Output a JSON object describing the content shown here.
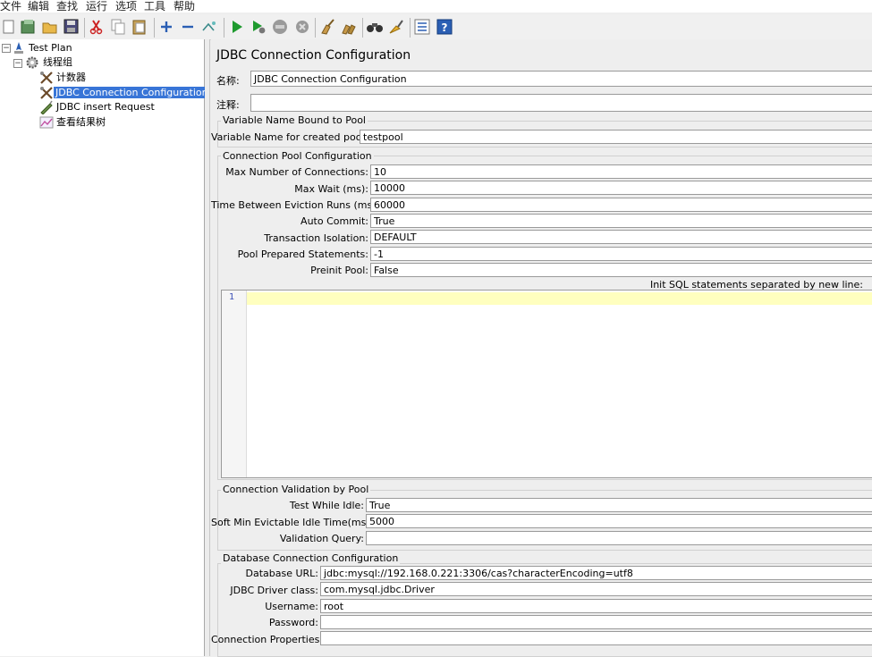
{
  "menu": [
    "文件",
    "编辑",
    "查找",
    "运行",
    "选项",
    "工具",
    "帮助"
  ],
  "toolbar_icons": [
    "new-icon",
    "templates-icon",
    "open-icon",
    "save-icon",
    "cut-icon",
    "copy-icon",
    "paste-icon",
    "expand-icon",
    "collapse-icon",
    "toggle-icon",
    "start-icon",
    "start-no-pause-icon",
    "stop-icon",
    "shutdown-icon",
    "clear-icon",
    "clear-all-icon",
    "search-icon",
    "reset-search-icon",
    "function-helper-icon",
    "help-icon"
  ],
  "tree": {
    "test_plan": "Test Plan",
    "thread_group": "线程组",
    "counter": "计数器",
    "jdbc_config": "JDBC Connection Configuration",
    "jdbc_request": "JDBC insert Request",
    "results_tree": "查看结果树"
  },
  "panel": {
    "title": "JDBC Connection Configuration",
    "name_label": "名称:",
    "name_value": "JDBC Connection Configuration",
    "comment_label": "注释:",
    "comment_value": "",
    "variable_group": {
      "title": "Variable Name Bound to Pool",
      "label": "Variable Name for created pool:",
      "value": "testpool"
    },
    "pool_group": {
      "title": "Connection Pool Configuration",
      "max_conn_label": "Max Number of Connections:",
      "max_conn_value": "10",
      "max_wait_label": "Max Wait (ms):",
      "max_wait_value": "10000",
      "eviction_label": "Time Between Eviction Runs (ms):",
      "eviction_value": "60000",
      "autocommit_label": "Auto Commit:",
      "autocommit_value": "True",
      "isolation_label": "Transaction Isolation:",
      "isolation_value": "DEFAULT",
      "prepared_label": "Pool Prepared Statements:",
      "prepared_value": "-1",
      "preinit_label": "Preinit Pool:",
      "preinit_value": "False",
      "init_sql_label": "Init SQL statements separated by new line:",
      "init_sql_line": "1"
    },
    "validation_group": {
      "title": "Connection Validation by Pool",
      "idle_label": "Test While Idle:",
      "idle_value": "True",
      "evictable_label": "Soft Min Evictable Idle Time(ms):",
      "evictable_value": "5000",
      "query_label": "Validation Query:",
      "query_value": ""
    },
    "db_group": {
      "title": "Database Connection Configuration",
      "url_label": "Database URL:",
      "url_value": "jdbc:mysql://192.168.0.221:3306/cas?characterEncoding=utf8",
      "driver_label": "JDBC Driver class:",
      "driver_value": "com.mysql.jdbc.Driver",
      "username_label": "Username:",
      "username_value": "root",
      "password_label": "Password:",
      "password_value": "",
      "props_label": "Connection Properties:",
      "props_value": ""
    }
  },
  "colors": {
    "selection": "#3875d7",
    "current_line": "#ffffbf",
    "line_number": "#3a4eb5"
  }
}
